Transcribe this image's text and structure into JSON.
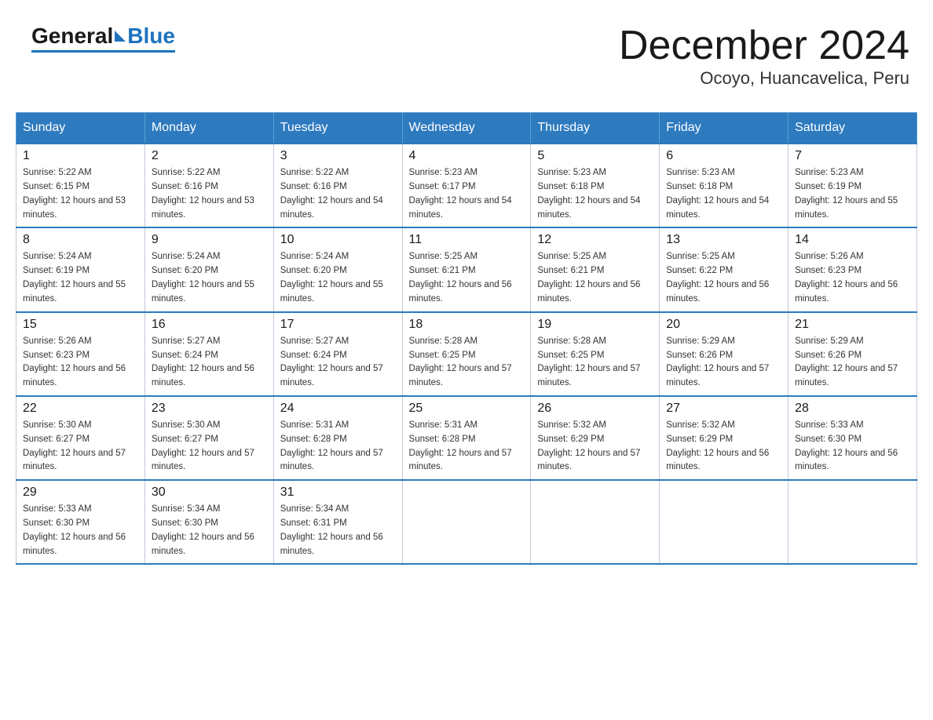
{
  "header": {
    "logo_general": "General",
    "logo_blue": "Blue",
    "month_title": "December 2024",
    "location": "Ocoyo, Huancavelica, Peru"
  },
  "days_of_week": [
    "Sunday",
    "Monday",
    "Tuesday",
    "Wednesday",
    "Thursday",
    "Friday",
    "Saturday"
  ],
  "weeks": [
    [
      {
        "day": "1",
        "sunrise": "5:22 AM",
        "sunset": "6:15 PM",
        "daylight": "12 hours and 53 minutes."
      },
      {
        "day": "2",
        "sunrise": "5:22 AM",
        "sunset": "6:16 PM",
        "daylight": "12 hours and 53 minutes."
      },
      {
        "day": "3",
        "sunrise": "5:22 AM",
        "sunset": "6:16 PM",
        "daylight": "12 hours and 54 minutes."
      },
      {
        "day": "4",
        "sunrise": "5:23 AM",
        "sunset": "6:17 PM",
        "daylight": "12 hours and 54 minutes."
      },
      {
        "day": "5",
        "sunrise": "5:23 AM",
        "sunset": "6:18 PM",
        "daylight": "12 hours and 54 minutes."
      },
      {
        "day": "6",
        "sunrise": "5:23 AM",
        "sunset": "6:18 PM",
        "daylight": "12 hours and 54 minutes."
      },
      {
        "day": "7",
        "sunrise": "5:23 AM",
        "sunset": "6:19 PM",
        "daylight": "12 hours and 55 minutes."
      }
    ],
    [
      {
        "day": "8",
        "sunrise": "5:24 AM",
        "sunset": "6:19 PM",
        "daylight": "12 hours and 55 minutes."
      },
      {
        "day": "9",
        "sunrise": "5:24 AM",
        "sunset": "6:20 PM",
        "daylight": "12 hours and 55 minutes."
      },
      {
        "day": "10",
        "sunrise": "5:24 AM",
        "sunset": "6:20 PM",
        "daylight": "12 hours and 55 minutes."
      },
      {
        "day": "11",
        "sunrise": "5:25 AM",
        "sunset": "6:21 PM",
        "daylight": "12 hours and 56 minutes."
      },
      {
        "day": "12",
        "sunrise": "5:25 AM",
        "sunset": "6:21 PM",
        "daylight": "12 hours and 56 minutes."
      },
      {
        "day": "13",
        "sunrise": "5:25 AM",
        "sunset": "6:22 PM",
        "daylight": "12 hours and 56 minutes."
      },
      {
        "day": "14",
        "sunrise": "5:26 AM",
        "sunset": "6:23 PM",
        "daylight": "12 hours and 56 minutes."
      }
    ],
    [
      {
        "day": "15",
        "sunrise": "5:26 AM",
        "sunset": "6:23 PM",
        "daylight": "12 hours and 56 minutes."
      },
      {
        "day": "16",
        "sunrise": "5:27 AM",
        "sunset": "6:24 PM",
        "daylight": "12 hours and 56 minutes."
      },
      {
        "day": "17",
        "sunrise": "5:27 AM",
        "sunset": "6:24 PM",
        "daylight": "12 hours and 57 minutes."
      },
      {
        "day": "18",
        "sunrise": "5:28 AM",
        "sunset": "6:25 PM",
        "daylight": "12 hours and 57 minutes."
      },
      {
        "day": "19",
        "sunrise": "5:28 AM",
        "sunset": "6:25 PM",
        "daylight": "12 hours and 57 minutes."
      },
      {
        "day": "20",
        "sunrise": "5:29 AM",
        "sunset": "6:26 PM",
        "daylight": "12 hours and 57 minutes."
      },
      {
        "day": "21",
        "sunrise": "5:29 AM",
        "sunset": "6:26 PM",
        "daylight": "12 hours and 57 minutes."
      }
    ],
    [
      {
        "day": "22",
        "sunrise": "5:30 AM",
        "sunset": "6:27 PM",
        "daylight": "12 hours and 57 minutes."
      },
      {
        "day": "23",
        "sunrise": "5:30 AM",
        "sunset": "6:27 PM",
        "daylight": "12 hours and 57 minutes."
      },
      {
        "day": "24",
        "sunrise": "5:31 AM",
        "sunset": "6:28 PM",
        "daylight": "12 hours and 57 minutes."
      },
      {
        "day": "25",
        "sunrise": "5:31 AM",
        "sunset": "6:28 PM",
        "daylight": "12 hours and 57 minutes."
      },
      {
        "day": "26",
        "sunrise": "5:32 AM",
        "sunset": "6:29 PM",
        "daylight": "12 hours and 57 minutes."
      },
      {
        "day": "27",
        "sunrise": "5:32 AM",
        "sunset": "6:29 PM",
        "daylight": "12 hours and 56 minutes."
      },
      {
        "day": "28",
        "sunrise": "5:33 AM",
        "sunset": "6:30 PM",
        "daylight": "12 hours and 56 minutes."
      }
    ],
    [
      {
        "day": "29",
        "sunrise": "5:33 AM",
        "sunset": "6:30 PM",
        "daylight": "12 hours and 56 minutes."
      },
      {
        "day": "30",
        "sunrise": "5:34 AM",
        "sunset": "6:30 PM",
        "daylight": "12 hours and 56 minutes."
      },
      {
        "day": "31",
        "sunrise": "5:34 AM",
        "sunset": "6:31 PM",
        "daylight": "12 hours and 56 minutes."
      },
      null,
      null,
      null,
      null
    ]
  ]
}
